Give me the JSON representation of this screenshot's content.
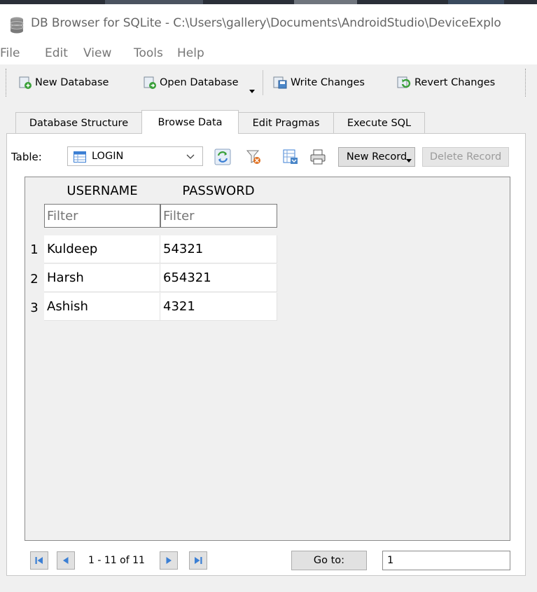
{
  "window": {
    "title": "DB Browser for SQLite - C:\\Users\\gallery\\Documents\\AndroidStudio\\DeviceExplo"
  },
  "menu": [
    "File",
    "Edit",
    "View",
    "Tools",
    "Help"
  ],
  "toolbar": {
    "new_database": "New Database",
    "open_database": "Open Database",
    "write_changes": "Write Changes",
    "revert_changes": "Revert Changes"
  },
  "tabs": [
    "Database Structure",
    "Browse Data",
    "Edit Pragmas",
    "Execute SQL"
  ],
  "active_tab": "Browse Data",
  "browse": {
    "table_label": "Table:",
    "table_selected": "LOGIN",
    "new_record": "New Record",
    "delete_record": "Delete Record"
  },
  "grid": {
    "columns": [
      "USERNAME",
      "PASSWORD"
    ],
    "filter_placeholder": "Filter",
    "rows": [
      {
        "num": "1",
        "username": "Kuldeep",
        "password": "54321"
      },
      {
        "num": "2",
        "username": "Harsh",
        "password": "654321"
      },
      {
        "num": "3",
        "username": "Ashish",
        "password": "4321"
      }
    ]
  },
  "navigation": {
    "record_range": "1 - 11 of 11",
    "goto_label": "Go to:",
    "goto_value": "1"
  },
  "colors": {
    "accent_blue": "#3b7fd4",
    "disabled_text": "#9b9b9b"
  }
}
